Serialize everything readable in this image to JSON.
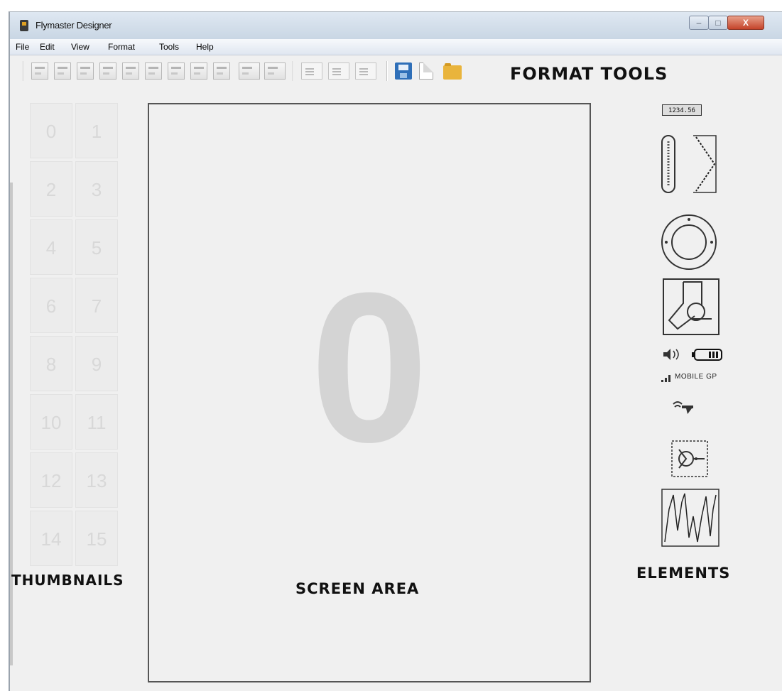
{
  "window": {
    "title": "Flymaster Designer",
    "minimize": "–",
    "maximize": "□",
    "close": "X"
  },
  "menu": [
    "File",
    "Edit",
    "View",
    "Format",
    "Tools",
    "Help"
  ],
  "toolbar": {
    "caption": "FORMAT TOOLS"
  },
  "thumbnails": {
    "caption": "THUMBNAILS",
    "items": [
      "0",
      "1",
      "2",
      "3",
      "4",
      "5",
      "6",
      "7",
      "8",
      "9",
      "10",
      "11",
      "12",
      "13",
      "14",
      "15"
    ]
  },
  "screen": {
    "caption": "SCREEN AREA",
    "number": "0"
  },
  "elements": {
    "caption": "ELEMENTS",
    "digital_readout": "1234.56",
    "mobile_label": "MOBILE GP",
    "icon_names": [
      "digital-display-icon",
      "vario-bar-icon",
      "vario-chevron-icon",
      "compass-icon",
      "map-icon",
      "sound-icon",
      "battery-icon",
      "signal-icon",
      "satellite-icon",
      "wind-icon",
      "graph-icon"
    ]
  }
}
